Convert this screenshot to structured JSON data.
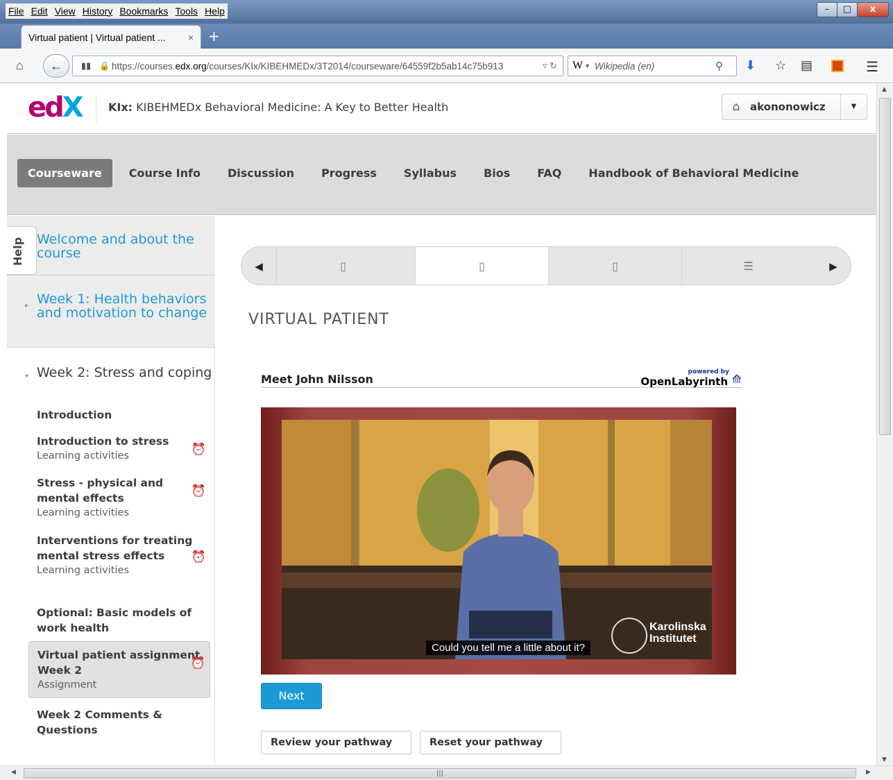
{
  "menubar": {
    "items": [
      "File",
      "Edit",
      "View",
      "History",
      "Bookmarks",
      "Tools",
      "Help"
    ]
  },
  "window_controls": [
    "–",
    "□",
    "x"
  ],
  "tab": {
    "title": "Virtual patient | Virtual patient ...",
    "close": "×",
    "new_tab": "+"
  },
  "navbar": {
    "url_prefix": "https://courses.",
    "url_domain": "edx.org",
    "url_path": "/courses/KIx/KIBEHMEDx/3T2014/courseware/64559f2b5ab14c75b913",
    "search_engine_glyph": "W",
    "search_placeholder": "Wikipedia (en)"
  },
  "edx_header": {
    "logo_e": "e",
    "logo_d": "d",
    "logo_x": "X",
    "course_code": "KIx:",
    "course_name": "KIBEHMEDx Behavioral Medicine: A Key to Better Health",
    "username": "akononowicz"
  },
  "course_nav": {
    "items": [
      "Courseware",
      "Course Info",
      "Discussion",
      "Progress",
      "Syllabus",
      "Bios",
      "FAQ",
      "Handbook of Behavioral Medicine"
    ],
    "active": "Courseware"
  },
  "sidebar": {
    "help_label": "Help",
    "chapters": [
      {
        "title": "Welcome and about the course"
      },
      {
        "title": "Week 1: Health behaviors and motivation to change"
      },
      {
        "title": "Week 2: Stress and coping"
      }
    ],
    "sections": [
      {
        "title": "Introduction",
        "subtitle": ""
      },
      {
        "title": "Introduction to stress",
        "subtitle": "Learning activities"
      },
      {
        "title": "Stress - physical and mental effects",
        "subtitle": "Learning activities"
      },
      {
        "title": "Interventions for treating mental stress effects",
        "subtitle": "Learning activities"
      },
      {
        "title": "Optional: Basic models of work health",
        "subtitle": ""
      },
      {
        "title": "Virtual patient assignment Week 2",
        "subtitle": "Assignment"
      },
      {
        "title": "Week 2 Comments & Questions",
        "subtitle": ""
      }
    ]
  },
  "main": {
    "unit_title": "VIRTUAL PATIENT",
    "vp_title": "Meet John Nilsson",
    "ol_powered": "powered by",
    "ol_name": "OpenLabyrinth",
    "video_subtitle": "Could you tell me a little about it?",
    "ki_line1": "Karolinska",
    "ki_line2": "Institutet",
    "next_label": "Next",
    "review_label": "Review your pathway",
    "reset_label": "Reset your pathway"
  },
  "colors": {
    "accent": "#1d9ad6",
    "edx_magenta": "#b5006e",
    "edx_blue": "#00a4e4",
    "nav_active": "#7b7b7b"
  }
}
